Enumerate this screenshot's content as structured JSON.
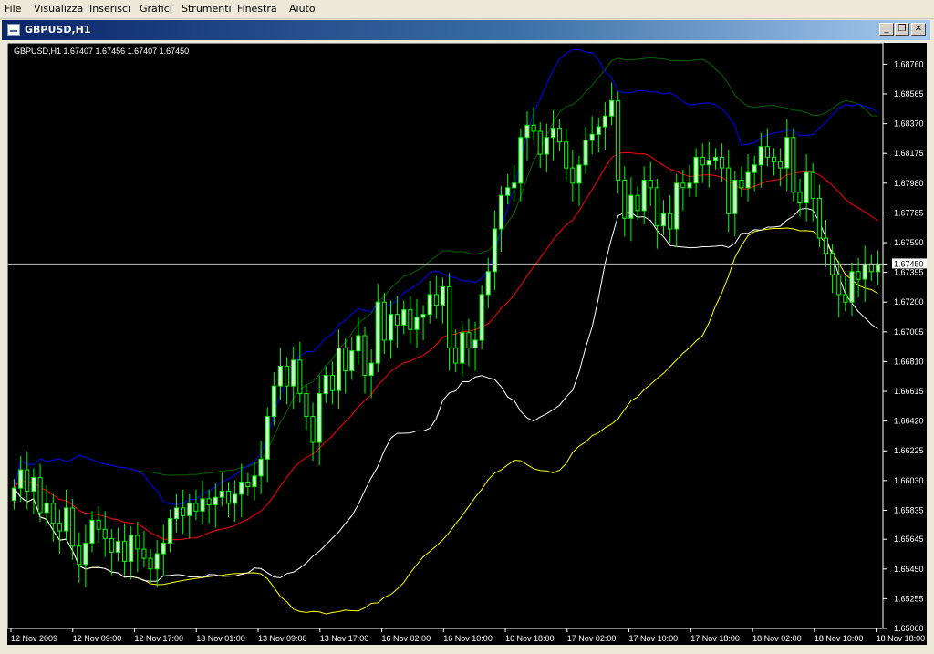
{
  "menu": {
    "items": [
      "File",
      "Visualizza",
      "Inserisci",
      "Grafici",
      "Strumenti",
      "Finestra",
      "Aiuto"
    ]
  },
  "window": {
    "title": "GBPUSD,H1",
    "buttons": {
      "minimize": "_",
      "restore": "❐",
      "close": "✕"
    }
  },
  "chart": {
    "info_line": "GBPUSD,H1  1.67407 1.67456 1.67407 1.67450",
    "current_price_label": "1.67450",
    "secondary_price_label": "1.67395",
    "colors": {
      "background": "#000000",
      "bull_candle": "#ccffcc",
      "wick": "#00ff00",
      "middle_band": "#ff0000",
      "upper_band_blue": "#0000ff",
      "lower_band_white": "#ffffff",
      "upper_band_green": "#006400",
      "lower_band_yellow": "#ffff00",
      "price_line": "#c0c0c0"
    }
  },
  "chart_data": {
    "type": "candlestick",
    "symbol": "GBPUSD",
    "timeframe": "H1",
    "ylim": [
      1.6506,
      1.689
    ],
    "current_price": 1.6745,
    "y_ticks": [
      "1.68760",
      "1.68565",
      "1.68370",
      "1.68175",
      "1.67980",
      "1.67785",
      "1.67590",
      "1.67450",
      "1.67395",
      "1.67200",
      "1.67005",
      "1.66810",
      "1.66615",
      "1.66420",
      "1.66225",
      "1.66030",
      "1.65835",
      "1.65645",
      "1.65450",
      "1.65255",
      "1.65060"
    ],
    "x_ticks": [
      "12 Nov 2009",
      "12 Nov 09:00",
      "12 Nov 17:00",
      "13 Nov 01:00",
      "13 Nov 09:00",
      "13 Nov 17:00",
      "16 Nov 02:00",
      "16 Nov 10:00",
      "16 Nov 18:00",
      "17 Nov 02:00",
      "17 Nov 10:00",
      "17 Nov 18:00",
      "18 Nov 02:00",
      "18 Nov 10:00",
      "18 Nov 18:00"
    ],
    "close_prices": [
      1.6598,
      1.661,
      1.6596,
      1.6605,
      1.6582,
      1.6588,
      1.6575,
      1.657,
      1.6585,
      1.656,
      1.6548,
      1.6562,
      1.6577,
      1.6571,
      1.6565,
      1.6556,
      1.6563,
      1.655,
      1.6567,
      1.6558,
      1.6552,
      1.6545,
      1.6555,
      1.6562,
      1.6578,
      1.6585,
      1.658,
      1.6588,
      1.6583,
      1.6591,
      1.6587,
      1.6592,
      1.6596,
      1.6588,
      1.6594,
      1.6602,
      1.6599,
      1.6606,
      1.6617,
      1.6645,
      1.6665,
      1.6678,
      1.6665,
      1.6682,
      1.666,
      1.6645,
      1.6628,
      1.666,
      1.6672,
      1.6662,
      1.669,
      1.6675,
      1.6688,
      1.6698,
      1.6672,
      1.668,
      1.672,
      1.6695,
      1.6712,
      1.6705,
      1.6715,
      1.6702,
      1.671,
      1.6712,
      1.6725,
      1.6718,
      1.673,
      1.669,
      1.668,
      1.67,
      1.669,
      1.6695,
      1.6725,
      1.674,
      1.6768,
      1.679,
      1.6795,
      1.6798,
      1.6828,
      1.6836,
      1.6832,
      1.6817,
      1.6828,
      1.6834,
      1.6825,
      1.6808,
      1.6798,
      1.681,
      1.6826,
      1.683,
      1.6835,
      1.6842,
      1.6852,
      1.68,
      1.6775,
      1.679,
      1.678,
      1.68,
      1.6795,
      1.677,
      1.6778,
      1.6768,
      1.6798,
      1.6795,
      1.6798,
      1.6815,
      1.681,
      1.6813,
      1.6815,
      1.6808,
      1.6778,
      1.68,
      1.6795,
      1.6805,
      1.681,
      1.6822,
      1.6815,
      1.6812,
      1.6808,
      1.6828,
      1.6792,
      1.6785,
      1.6805,
      1.6788,
      1.6762,
      1.6752,
      1.6738,
      1.6725,
      1.672,
      1.674,
      1.6735,
      1.6745,
      1.674,
      1.6745
    ]
  }
}
